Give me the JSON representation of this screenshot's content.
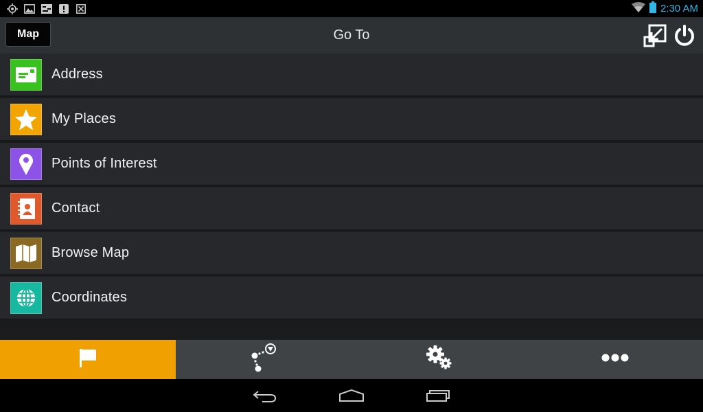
{
  "status_bar": {
    "left_icons": [
      "location-icon",
      "image-icon",
      "keyboard-icon",
      "alert-icon",
      "close-box-icon"
    ],
    "right_icons": [
      "wifi-icon",
      "battery-icon"
    ],
    "time": "2:30 AM",
    "time_color": "#33b5e5"
  },
  "header": {
    "map_button_label": "Map",
    "title": "Go To",
    "icons": [
      "expand-icon",
      "power-icon"
    ]
  },
  "menu": {
    "items": [
      {
        "label": "Address",
        "icon": "address-card-icon",
        "color": "#39c21d"
      },
      {
        "label": "My Places",
        "icon": "star-icon",
        "color": "#f2a400"
      },
      {
        "label": "Points of Interest",
        "icon": "location-pin-icon",
        "color": "#8c53e6"
      },
      {
        "label": "Contact",
        "icon": "contact-book-icon",
        "color": "#e0592a"
      },
      {
        "label": "Browse Map",
        "icon": "folded-map-icon",
        "color": "#8a6a22"
      },
      {
        "label": "Coordinates",
        "icon": "globe-icon",
        "color": "#17b8a0"
      }
    ]
  },
  "tabs": {
    "items": [
      {
        "icon": "flag-icon",
        "active": true
      },
      {
        "icon": "route-icon",
        "active": false
      },
      {
        "icon": "settings-gears-icon",
        "active": false
      },
      {
        "icon": "more-dots-icon",
        "active": false
      }
    ],
    "active_color": "#f0a000"
  },
  "nav_bar": {
    "icons": [
      "back-icon",
      "home-icon",
      "recent-apps-icon"
    ]
  }
}
